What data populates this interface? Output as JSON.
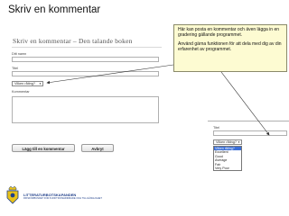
{
  "slide": {
    "title": "Skriv en kommentar"
  },
  "form": {
    "title": "Skriv en kommentar – Den talande boken",
    "name_label": "Ditt namn",
    "title_label": "Titel",
    "comment_label": "Kommentar",
    "rating_selected": "Vilken råting?",
    "submit_label": "Lägg till en kommentar",
    "cancel_label": "Avbryt"
  },
  "callout": {
    "line1": "Här kan posta en kommentar och även lägga in en gradering gällande programmet.",
    "line2": "Använd gärna funktionen för att dela med dig av din erfarenhet av programmet."
  },
  "zoom": {
    "title_label": "Titel",
    "rating_selected": "Vilken råting?",
    "options": [
      "Vilken råting?",
      "Excellent",
      "Good",
      "Average",
      "Fair",
      "Very Poor"
    ]
  },
  "footer": {
    "org_name": "LITTERATURBOTSKAPANDEN",
    "org_sub": "RIKSFÖRBUNDET FÖR FUNKTIONSHINDRADE OCH TILLGÄNGLIGHET"
  },
  "colors": {
    "callout_bg": "#fdfbd2",
    "arrow": "#333333",
    "org_blue": "#1f3f8a",
    "highlight": "#3a6fd8"
  }
}
